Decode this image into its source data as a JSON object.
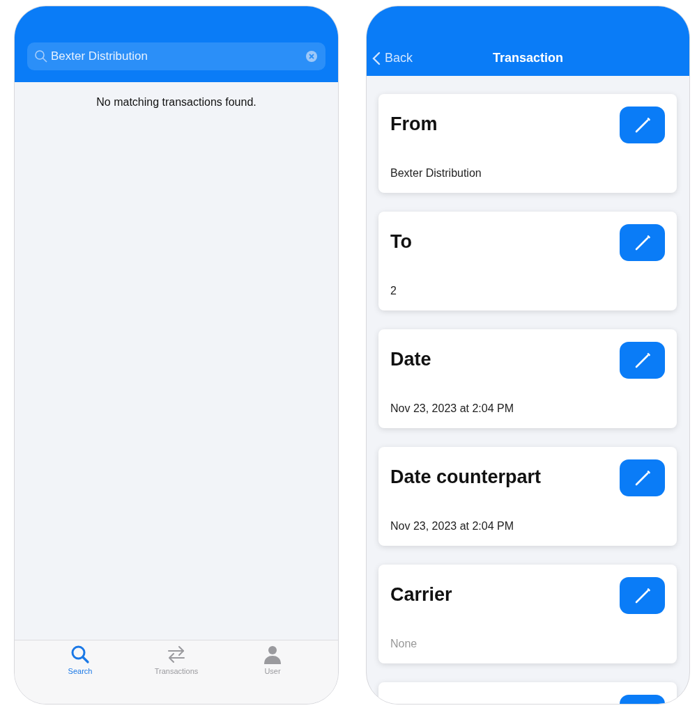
{
  "search_screen": {
    "search": {
      "value": "Bexter Distribution"
    },
    "empty_message": "No matching transactions found.",
    "tabs": [
      {
        "label": "Search",
        "selected": true,
        "kind": "search"
      },
      {
        "label": "Transactions",
        "selected": false,
        "kind": "transfer"
      },
      {
        "label": "User",
        "selected": false,
        "kind": "user"
      }
    ]
  },
  "detail_screen": {
    "back": "Back",
    "title": "Transaction",
    "cards": [
      {
        "kind": "field",
        "title": "From",
        "value": "Bexter Distribution",
        "muted": false
      },
      {
        "kind": "field",
        "title": "To",
        "value": "2",
        "muted": false
      },
      {
        "kind": "field",
        "title": "Date",
        "value": "Nov 23, 2023 at 2:04 PM",
        "muted": false
      },
      {
        "kind": "field",
        "title": "Date counterpart",
        "value": "Nov 23, 2023 at 2:04 PM",
        "muted": false
      },
      {
        "kind": "field",
        "title": "Carrier",
        "value": "None",
        "muted": true
      },
      {
        "kind": "cut"
      }
    ]
  }
}
